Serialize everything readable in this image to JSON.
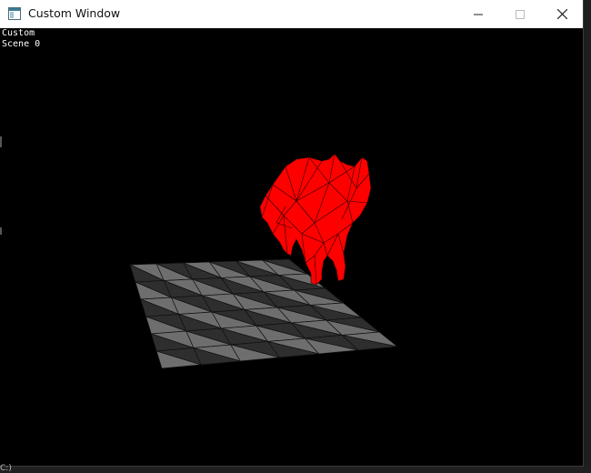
{
  "window": {
    "title": "Custom Window"
  },
  "titlebar": {
    "minimize_icon": "minimize-icon",
    "maximize_icon": "maximize-icon",
    "close_icon": "close-icon",
    "app_icon": "app-window-icon"
  },
  "viewport": {
    "line1": "Custom",
    "line2": "Scene 0",
    "background": "#000000",
    "model_color": "#ff0000",
    "floor_dark": "#2e2e2e",
    "floor_light": "#6e6e6e"
  },
  "taskbar": {
    "fragment": "C:)"
  }
}
